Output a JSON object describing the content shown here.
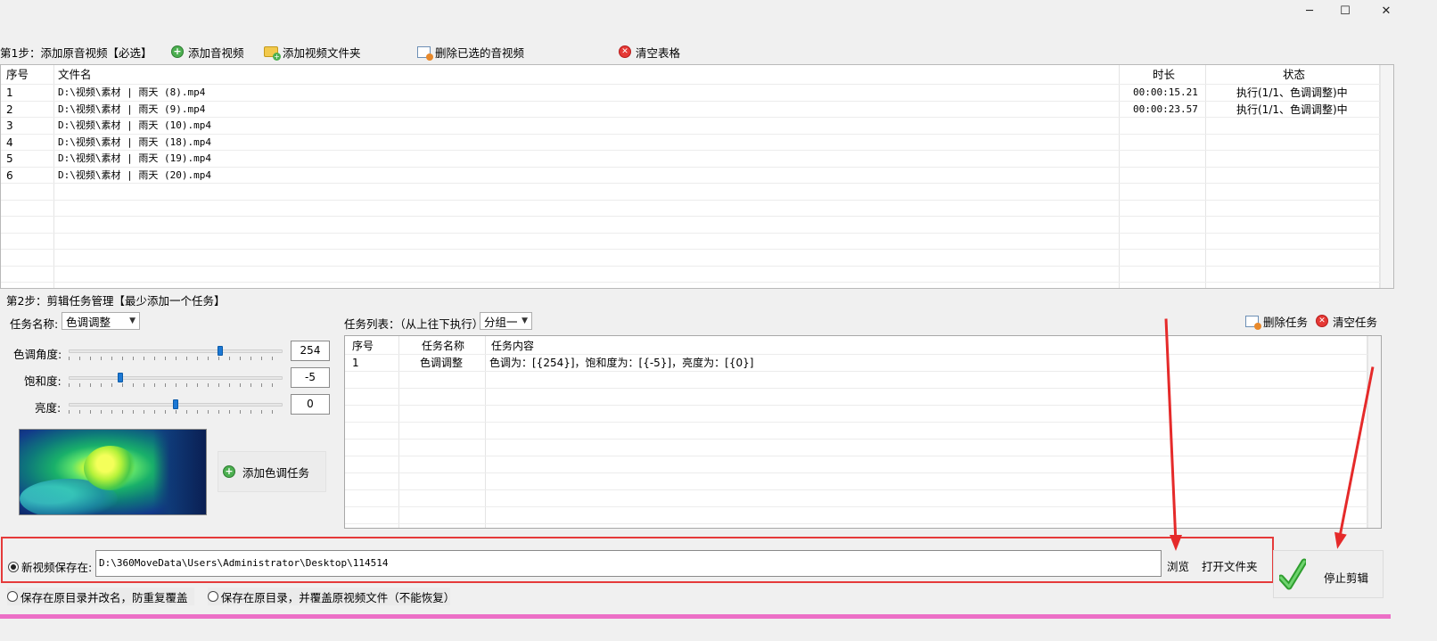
{
  "window": {
    "minimize_glyph": "─",
    "maximize_glyph": "☐",
    "close_glyph": "✕"
  },
  "step1": {
    "label": "第1步：添加原音视频【必选】",
    "buttons": {
      "add_media": "添加音视频",
      "add_folder": "添加视频文件夹",
      "delete_selected": "删除已选的音视频",
      "clear_table": "清空表格"
    },
    "columns": [
      "序号",
      "文件名",
      "时长",
      "状态"
    ],
    "rows": [
      {
        "no": "1",
        "file": "D:\\视频\\素材 | 雨天 (8).mp4",
        "duration": "00:00:15.21",
        "status": "执行(1/1、色调调整)中"
      },
      {
        "no": "2",
        "file": "D:\\视频\\素材 | 雨天 (9).mp4",
        "duration": "00:00:23.57",
        "status": "执行(1/1、色调调整)中"
      },
      {
        "no": "3",
        "file": "D:\\视频\\素材 | 雨天 (10).mp4",
        "duration": "",
        "status": ""
      },
      {
        "no": "4",
        "file": "D:\\视频\\素材 | 雨天 (18).mp4",
        "duration": "",
        "status": ""
      },
      {
        "no": "5",
        "file": "D:\\视频\\素材 | 雨天 (19).mp4",
        "duration": "",
        "status": ""
      },
      {
        "no": "6",
        "file": "D:\\视频\\素材 | 雨天 (20).mp4",
        "duration": "",
        "status": ""
      }
    ]
  },
  "step2": {
    "label": "第2步：剪辑任务管理【最少添加一个任务】",
    "task_name_label": "任务名称:",
    "task_name_value": "色调调整",
    "hue_label": "色调角度:",
    "hue_value": "254",
    "hue_level": 0.71,
    "saturation_label": "饱和度:",
    "saturation_value": "-5",
    "saturation_level": 0.24,
    "brightness_label": "亮度:",
    "brightness_value": "0",
    "brightness_level": 0.5,
    "add_task_button": "添加色调任务",
    "task_list_label": "任务列表：（从上往下执行）",
    "group_value": "分组一",
    "delete_task_button": "删除任务",
    "clear_tasks_button": "清空任务",
    "task_columns": [
      "序号",
      "任务名称",
      "任务内容"
    ],
    "tasks": [
      {
        "no": "1",
        "name": "色调调整",
        "content": "色调为：[{254}]，饱和度为：[{-5}]，亮度为：[{0}]"
      }
    ]
  },
  "save": {
    "new_location_label": "新视频保存在:",
    "path": "D:\\360MoveData\\Users\\Administrator\\Desktop\\114514",
    "browse_button": "浏览",
    "open_folder_button": "打开文件夹",
    "option_rename": "保存在原目录并改名，防重复覆盖",
    "option_overwrite": "保存在原目录，并覆盖原视频文件（不能恢复）",
    "stop_button": "停止剪辑"
  },
  "colors": {
    "highlight_red": "#e53a3a",
    "pink_bar": "#ec6fc6",
    "slider_thumb": "#1c78d4"
  }
}
